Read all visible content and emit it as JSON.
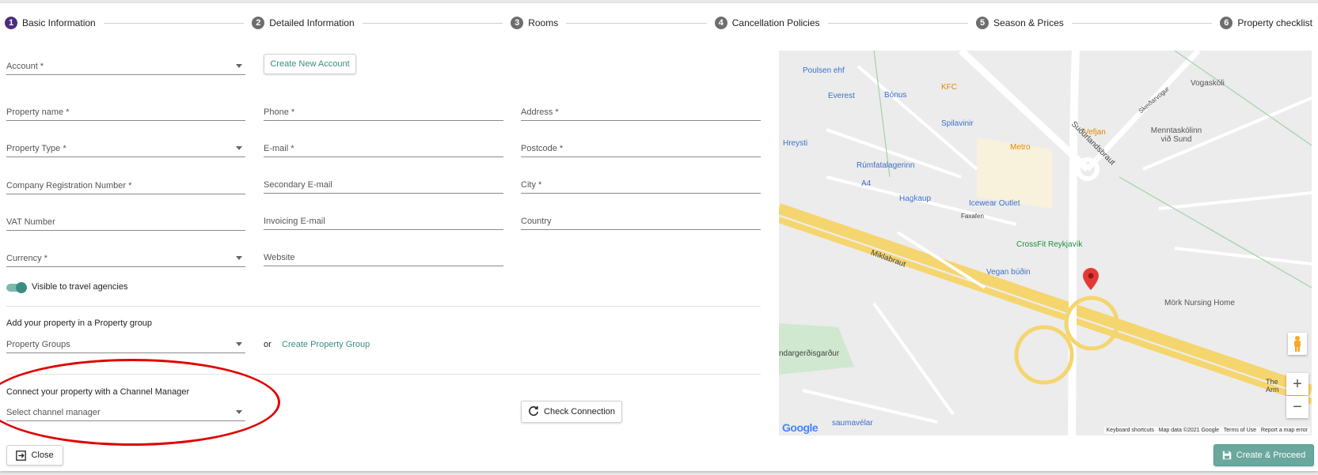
{
  "steps": [
    {
      "num": "1",
      "label": "Basic Information"
    },
    {
      "num": "2",
      "label": "Detailed Information"
    },
    {
      "num": "3",
      "label": "Rooms"
    },
    {
      "num": "4",
      "label": "Cancellation Policies"
    },
    {
      "num": "5",
      "label": "Season & Prices"
    },
    {
      "num": "6",
      "label": "Property checklist"
    }
  ],
  "form": {
    "account": "Account *",
    "create_account": "Create New Account",
    "property_name": "Property name *",
    "phone": "Phone *",
    "address": "Address *",
    "property_type": "Property Type *",
    "email": "E-mail *",
    "postcode": "Postcode *",
    "company_reg": "Company Registration Number *",
    "secondary_email": "Secondary E-mail",
    "city": "City *",
    "vat": "VAT Number",
    "invoicing_email": "Invoicing E-mail",
    "country": "Country",
    "currency": "Currency *",
    "website": "Website",
    "visible_label": "Visible to travel agencies",
    "group_heading": "Add your property in a Property group",
    "property_groups": "Property Groups",
    "or": "or",
    "create_group": "Create Property Group",
    "channel_heading": "Connect your property with a Channel Manager",
    "channel_select": "Select channel manager",
    "check_connection": "Check Connection",
    "close": "Close",
    "create_proceed": "Create & Proceed"
  },
  "map": {
    "labels": [
      "Poulsen ehf",
      "Bónus",
      "KFC",
      "Everest",
      "Spilavinir",
      "Vefjan",
      "Metro",
      "Hreysti",
      "Rúmfatalagerinn",
      "A4",
      "Hagkaup",
      "Icewear Outlet",
      "CrossFit Reykjavík",
      "Vegan búðin",
      "Mörk Nursing Home",
      "Vogaskóli",
      "Menntaskólinn við Sund",
      "Miklabraut",
      "Suðurlandsbraut",
      "ndargerðisgarður",
      "saumavélar",
      "Skeiðarvogur",
      "Faxafen",
      "The Arm"
    ],
    "footer": [
      "Keyboard shortcuts",
      "Map data ©2021 Google",
      "Terms of Use",
      "Report a map error"
    ],
    "google": "Google",
    "zoom_in": "+",
    "zoom_out": "−"
  },
  "colors": {
    "accent": "#3a8d83",
    "active_step": "#4b2d7f",
    "annotation": "#e00000"
  }
}
